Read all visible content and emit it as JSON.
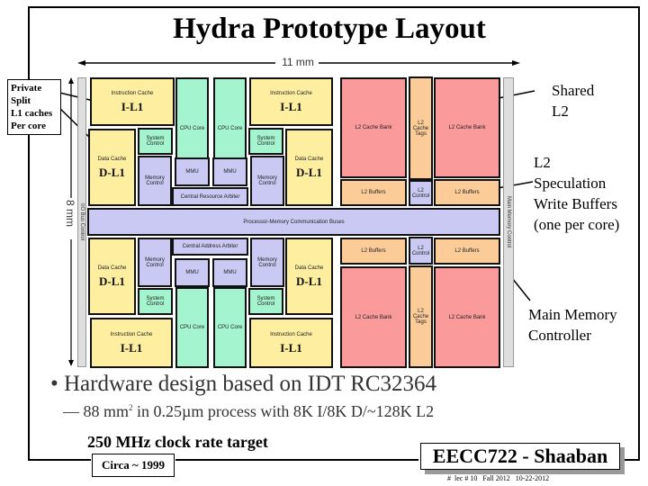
{
  "slide": {
    "title": "Hydra Prototype Layout",
    "width_label": "11 mm",
    "height_label": "8 mm"
  },
  "die": {
    "left_strip_label": "I/O Bus Control",
    "right_strip_label": "Main Memory Control",
    "top": {
      "icache_left": {
        "label": "Instruction Cache",
        "tag": "I-L1"
      },
      "cpu_left": "CPU Core",
      "cpu_right": "CPU Core",
      "icache_right": {
        "label": "Instruction Cache",
        "tag": "I-L1"
      },
      "sys_left": "System Control",
      "sys_right": "System Control",
      "dcache_left": {
        "label": "Data Cache",
        "tag": "D-L1"
      },
      "dcache_right": {
        "label": "Data Cache",
        "tag": "D-L1"
      },
      "memctl_left": "Memory Control",
      "memctl_right": "Memory Control",
      "mmu_left": "MMU",
      "mmu_right": "MMU",
      "arbiter": "Central Resource Arbiter",
      "l2bank_left": "L2 Cache Bank",
      "l2tags": "L2 Cache Tags",
      "l2bank_right": "L2 Cache Bank",
      "l2buf_left": "L2 Buffers",
      "l2ctl": "L2 Control",
      "l2buf_right": "L2 Buffers"
    },
    "bus": "Processor-Memory Communication Buses",
    "bottom": {
      "arbiter": "Central Address Arbiter",
      "memctl_left": "Memory Control",
      "memctl_right": "Memory Control",
      "mmu_left": "MMU",
      "mmu_right": "MMU",
      "dcache_left": {
        "label": "Data Cache",
        "tag": "D-L1"
      },
      "dcache_right": {
        "label": "Data Cache",
        "tag": "D-L1"
      },
      "sys_left": "System Control",
      "sys_right": "System Control",
      "cpu_left": "CPU Core",
      "cpu_right": "CPU Core",
      "icache_left": {
        "label": "Instruction Cache",
        "tag": "I-L1"
      },
      "icache_right": {
        "label": "Instruction Cache",
        "tag": "I-L1"
      },
      "l2buf_left": "L2 Buffers",
      "l2ctl": "L2 Control",
      "l2buf_right": "L2 Buffers",
      "l2bank_left": "L2 Cache Bank",
      "l2tags": "L2 Cache Tags",
      "l2bank_right": "L2 Cache Bank"
    }
  },
  "callouts": {
    "private_l1": [
      "Private",
      "Split",
      "L1 caches",
      "Per core"
    ],
    "shared_l2": [
      "Shared",
      "L2"
    ],
    "l2_spec": [
      "L2",
      "Speculation",
      "Write Buffers",
      "(one per core)"
    ],
    "main_mem": [
      "Main Memory",
      "Controller"
    ]
  },
  "bullets": {
    "main": "• Hardware design based on IDT RC32364",
    "sub_pre": "— 88 mm",
    "sub_sup": "2",
    "sub_post": " in 0.25µm process with 8K I/8K D/~128K L2",
    "clock": "250 MHz clock rate target",
    "circa": "Circa ~ 1999"
  },
  "footer": {
    "course": "EECC722 - Shaaban",
    "info": "#  lec # 10   Fall 2012   10-22-2012"
  }
}
